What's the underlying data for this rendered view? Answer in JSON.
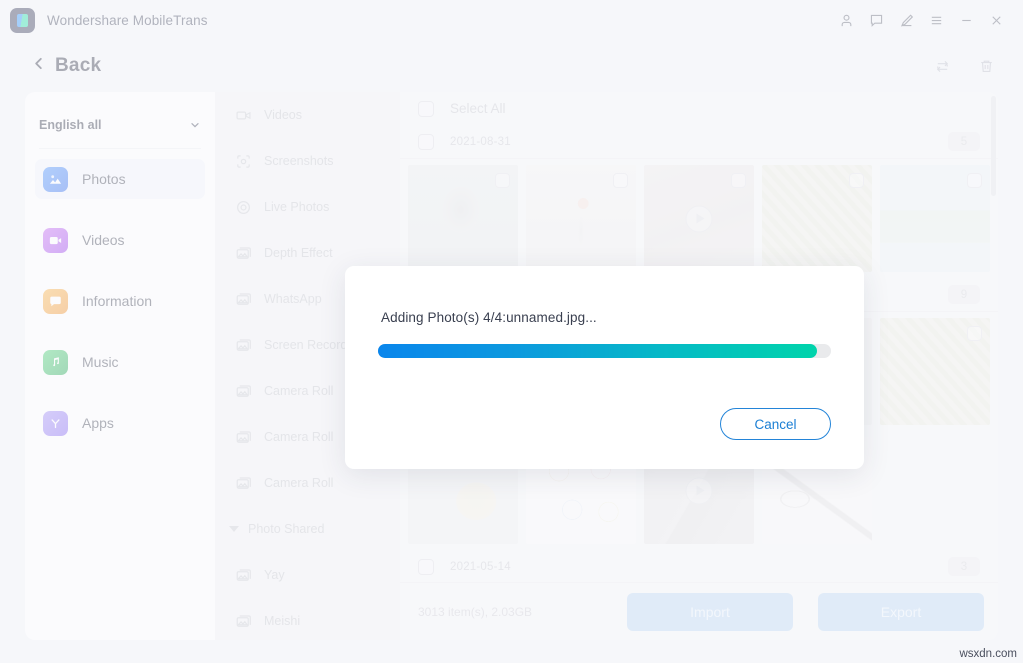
{
  "window": {
    "app_title": "Wondershare MobileTrans",
    "logo_icon": "mobiletrans-logo-icon",
    "controls": [
      {
        "name": "account-icon",
        "label": "Account"
      },
      {
        "name": "feedback-icon",
        "label": "Feedback"
      },
      {
        "name": "edit-icon",
        "label": "Edit"
      },
      {
        "name": "menu-icon",
        "label": "Menu"
      },
      {
        "name": "minimize-icon",
        "label": "Minimize"
      },
      {
        "name": "close-icon",
        "label": "Close"
      }
    ]
  },
  "subbar": {
    "back_label": "Back",
    "back_icon": "chevron-left-icon",
    "refresh_icon": "refresh-icon",
    "delete_icon": "trash-icon"
  },
  "sidebar": {
    "language": {
      "value": "English all",
      "caret_icon": "chevron-down-icon"
    },
    "items": [
      {
        "label": "Photos",
        "icon": "photo-icon",
        "active": true
      },
      {
        "label": "Videos",
        "icon": "video-icon",
        "active": false
      },
      {
        "label": "Information",
        "icon": "message-icon",
        "active": false
      },
      {
        "label": "Music",
        "icon": "music-note-icon",
        "active": false
      },
      {
        "label": "Apps",
        "icon": "apps-icon",
        "active": false
      }
    ]
  },
  "categories": [
    {
      "label": "Videos",
      "icon": "video-camera-icon",
      "type": "item"
    },
    {
      "label": "Screenshots",
      "icon": "screenshot-icon",
      "type": "item"
    },
    {
      "label": "Live Photos",
      "icon": "live-photo-icon",
      "type": "item"
    },
    {
      "label": "Depth Effect",
      "icon": "album-icon",
      "type": "item"
    },
    {
      "label": "WhatsApp",
      "icon": "album-icon",
      "type": "item"
    },
    {
      "label": "Screen Recorder",
      "icon": "album-icon",
      "type": "item"
    },
    {
      "label": "Camera Roll",
      "icon": "album-icon",
      "type": "item"
    },
    {
      "label": "Camera Roll",
      "icon": "album-icon",
      "type": "item"
    },
    {
      "label": "Camera Roll",
      "icon": "album-icon",
      "type": "item"
    },
    {
      "label": "Photo Shared",
      "icon": "triangle-down-icon",
      "type": "group"
    },
    {
      "label": "Yay",
      "icon": "album-icon",
      "type": "item"
    },
    {
      "label": "Meishi",
      "icon": "album-icon",
      "type": "item"
    }
  ],
  "main": {
    "select_all_label": "Select All",
    "groups": [
      {
        "date": "2021-08-31",
        "count": "5",
        "thumbs": [
          {
            "art": "t-person",
            "kind": "photo"
          },
          {
            "art": "t-flowers",
            "kind": "photo"
          },
          {
            "art": "t-videoA",
            "kind": "video"
          },
          {
            "art": "t-leaves",
            "kind": "photo"
          },
          {
            "art": "t-palms",
            "kind": "photo"
          }
        ]
      },
      {
        "date": "",
        "count": "9",
        "thumbs": [
          {
            "art": "t-leaves",
            "kind": "photo"
          }
        ]
      },
      {
        "date": "",
        "count": "",
        "thumbs": [
          {
            "art": "t-toto",
            "kind": "photo"
          },
          {
            "art": "t-info",
            "kind": "photo"
          },
          {
            "art": "t-videoB",
            "kind": "video"
          },
          {
            "art": "t-cable",
            "kind": "photo"
          }
        ]
      },
      {
        "date": "2021-05-14",
        "count": "3",
        "thumbs": []
      }
    ],
    "items_info": "3013 item(s), 2.03GB",
    "import_label": "Import",
    "export_label": "Export"
  },
  "modal": {
    "message": "Adding Photo(s) 4/4:unnamed.jpg...",
    "progress_percent": 97,
    "cancel_label": "Cancel",
    "progress_start_color": "#0A86EC",
    "progress_end_color": "#00D4AB"
  },
  "watermark": {
    "text": "wsxdn.com"
  }
}
